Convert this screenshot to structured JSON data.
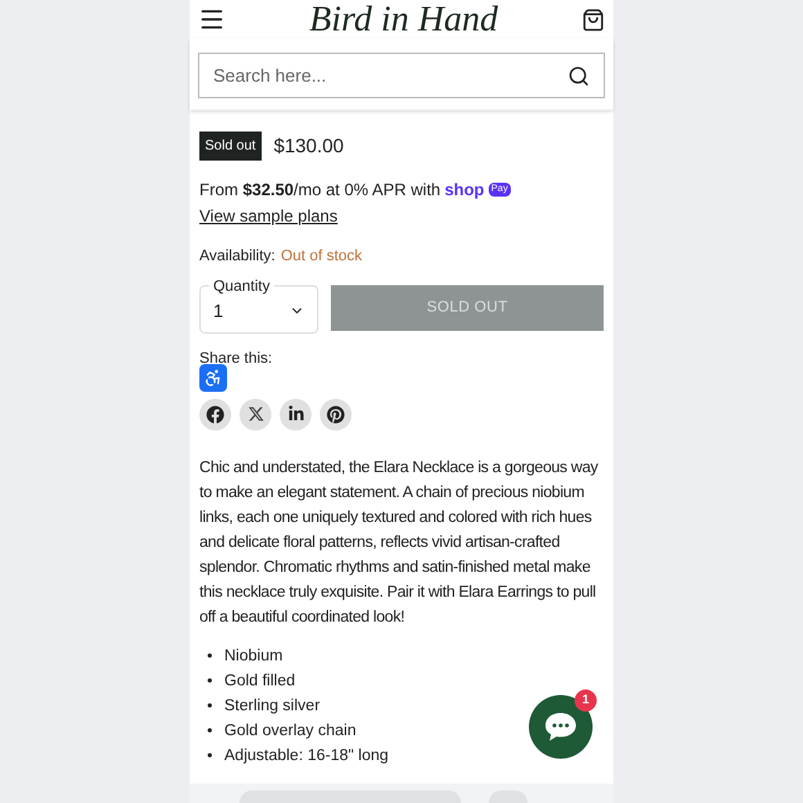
{
  "header": {
    "logo": "Bird in Hand"
  },
  "search": {
    "placeholder": "Search here..."
  },
  "product": {
    "badge": "Sold out",
    "price": "$130.00",
    "installments": "From **$32.50**/mo at 0% APR with",
    "shop_logo": "shop",
    "pay_badge": "Pay",
    "sample_plans_link": "View sample plans",
    "availability_label": "Availability:",
    "availability_value": "Out of stock",
    "quantity_label": "Quantity",
    "quantity_value": "1",
    "button": {
      "label": "SOLD OUT",
      "disabled": true
    }
  },
  "share": {
    "label": "Share this:",
    "networks": [
      {
        "kind": "facebook"
      },
      {
        "kind": "x"
      },
      {
        "kind": "linkedin"
      },
      {
        "kind": "pinterest"
      }
    ]
  },
  "description": "Chic and understated, the Elara Necklace is a gorgeous way to make an elegant statement. A chain of precious niobium links, each one uniquely textured and colored with rich hues and delicate floral patterns, reflects vivid artisan-crafted splendor. Chromatic rhythms and satin-finished metal make this necklace truly exquisite. Pair it with Elara Earrings to pull off a beautiful coordinated look!",
  "features": [
    "Niobium",
    "Gold filled",
    "Sterling silver",
    "Gold overlay chain",
    "Adjustable: 16-18\" long"
  ],
  "chat": {
    "badge": "1"
  }
}
